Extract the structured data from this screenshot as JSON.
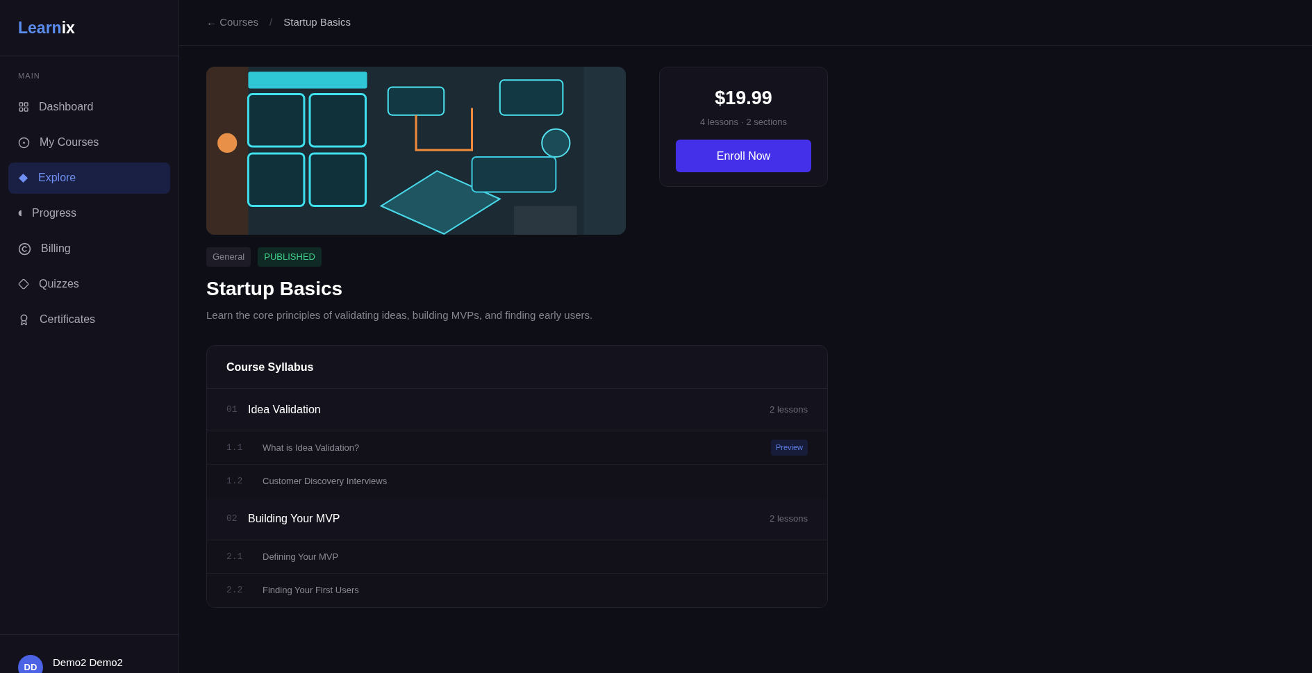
{
  "logo": {
    "accent": "Learn",
    "rest": "ix"
  },
  "sidebar": {
    "section": "MAIN",
    "items": [
      {
        "label": "Dashboard",
        "selected": false
      },
      {
        "label": "My Courses",
        "selected": false
      },
      {
        "label": "Explore",
        "selected": true
      },
      {
        "label": "Progress",
        "selected": false
      },
      {
        "label": "Billing",
        "selected": false
      },
      {
        "label": "Quizzes",
        "selected": false
      },
      {
        "label": "Certificates",
        "selected": false
      }
    ],
    "user": {
      "initials": "DD",
      "name": "Demo2 Demo2"
    }
  },
  "breadcrumb": {
    "back": "← Courses",
    "separator": "/",
    "current": "Startup Basics"
  },
  "course": {
    "tags": [
      {
        "label": "General",
        "kind": "category"
      },
      {
        "label": "PUBLISHED",
        "kind": "status"
      }
    ],
    "title": "Startup Basics",
    "description": "Learn the core principles of validating ideas, building MVPs, and finding early users."
  },
  "price_card": {
    "price": "$19.99",
    "meta": "4 lessons · 2 sections",
    "button": "Enroll Now"
  },
  "syllabus": {
    "title": "Course Syllabus",
    "sections": [
      {
        "number": "01",
        "title": "Idea Validation",
        "count": "2 lessons",
        "lessons": [
          {
            "number": "1.1",
            "title": "What is Idea Validation?",
            "preview": true,
            "badge": "Preview"
          },
          {
            "number": "1.2",
            "title": "Customer Discovery Interviews",
            "preview": false
          }
        ]
      },
      {
        "number": "02",
        "title": "Building Your MVP",
        "count": "2 lessons",
        "lessons": [
          {
            "number": "2.1",
            "title": "Defining Your MVP",
            "preview": false
          },
          {
            "number": "2.2",
            "title": "Finding Your First Users",
            "preview": false
          }
        ]
      }
    ]
  }
}
